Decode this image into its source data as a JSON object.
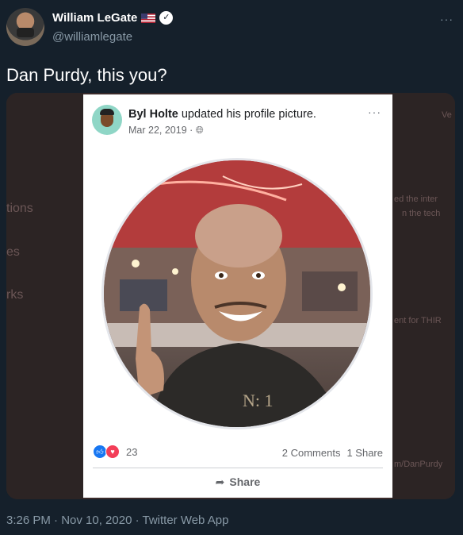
{
  "author": {
    "name": "William LeGate",
    "handle": "@williamlegate",
    "flag_icon": "us-flag-icon",
    "verified_icon": "verified-badge-icon"
  },
  "tweet": {
    "text": "Dan Purdy, this you?",
    "timestamp": "3:26 PM · Nov 10, 2020 · Twitter Web App"
  },
  "background_fragments": {
    "left": [
      "tions",
      "es",
      "rks"
    ],
    "right": [
      "Ve",
      "ed the inter",
      "n the tech",
      "ent for THIR",
      "m/DanPurdy"
    ]
  },
  "fb_post": {
    "author": "Byl Holte",
    "action": " updated his profile picture.",
    "date": "Mar 22, 2019 · ",
    "privacy_icon": "globe-icon",
    "reaction_count": "23",
    "comments": "2 Comments",
    "shares": "1 Share",
    "share_label": "Share"
  },
  "colors": {
    "background": "#15202b",
    "secondary_text": "#8899a6",
    "fb_blue": "#1877f2",
    "fb_love": "#f33e58"
  }
}
